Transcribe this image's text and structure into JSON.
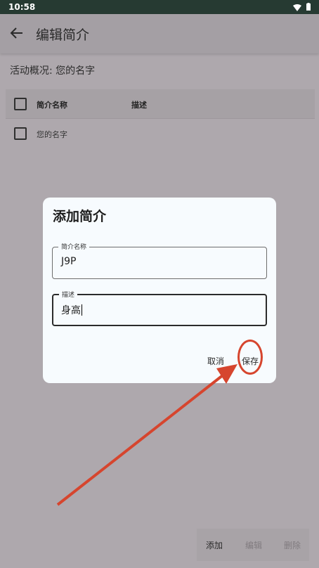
{
  "status_bar": {
    "time": "10:58"
  },
  "app_bar": {
    "title": "编辑简介"
  },
  "activity_summary": "活动概况: 您的名字",
  "table": {
    "columns": [
      "简介名称",
      "描述"
    ],
    "rows": [
      {
        "name": "您的名字",
        "description": ""
      }
    ]
  },
  "dialog": {
    "title": "添加简介",
    "fields": [
      {
        "label": "简介名称",
        "value": "J9P"
      },
      {
        "label": "描述",
        "value": "身高"
      }
    ],
    "cancel_label": "取消",
    "save_label": "保存"
  },
  "bottom_actions": {
    "add_label": "添加",
    "edit_label": "编辑",
    "delete_label": "删除"
  },
  "colors": {
    "annotation_red": "#d6452e",
    "dialog_bg": "#f7fbfe",
    "status_bar": "#263a32"
  }
}
